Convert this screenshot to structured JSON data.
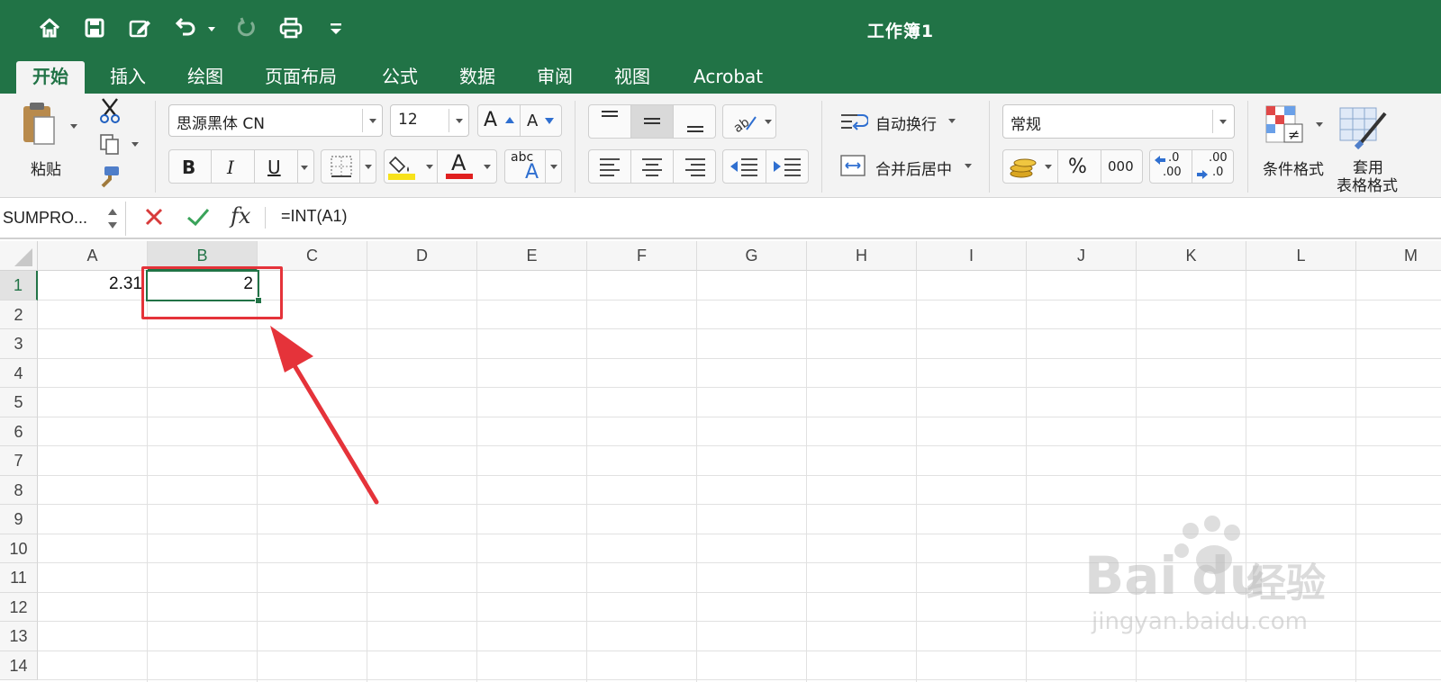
{
  "window": {
    "title": "工作簿1"
  },
  "tabs": [
    "开始",
    "插入",
    "绘图",
    "页面布局",
    "公式",
    "数据",
    "审阅",
    "视图",
    "Acrobat"
  ],
  "active_tab": "开始",
  "ribbon": {
    "paste_label": "粘贴",
    "font_name": "思源黑体 CN",
    "font_size": "12",
    "bold": "B",
    "italic": "I",
    "underline": "U",
    "font_color_glyph": "A",
    "abc_glyph": "abc",
    "abc_sub": "A",
    "grow_font": "A",
    "shrink_font": "A",
    "wrap_text": "自动换行",
    "merge_center": "合并后居中",
    "number_format": "常规",
    "percent": "%",
    "thousands": "000",
    "inc_decimal_top": ".0",
    "inc_decimal_bottom": ".00",
    "dec_decimal_top": ".00",
    "dec_decimal_bottom": ".0",
    "conditional_format": "条件格式",
    "table_format_line1": "套用",
    "table_format_line2": "表格格式"
  },
  "formula_bar": {
    "name_box": "SUMPRO...",
    "fx": "fx",
    "formula": "=INT(A1)"
  },
  "sheet": {
    "columns": [
      "A",
      "B",
      "C",
      "D",
      "E",
      "F",
      "G",
      "H",
      "I",
      "J",
      "K",
      "L",
      "M"
    ],
    "rows": [
      "1",
      "2",
      "3",
      "4",
      "5",
      "6",
      "7",
      "8",
      "9",
      "10",
      "11",
      "12",
      "13",
      "14"
    ],
    "cells": {
      "A1": "2.31",
      "B1": "2"
    },
    "selected_cell": "B1"
  },
  "watermark": {
    "brand": "Bai",
    "brand_tail": "du",
    "jingyan": "经验",
    "url": "jingyan.baidu.com"
  },
  "colors": {
    "accent": "#217346",
    "highlight": "#e5333a"
  }
}
